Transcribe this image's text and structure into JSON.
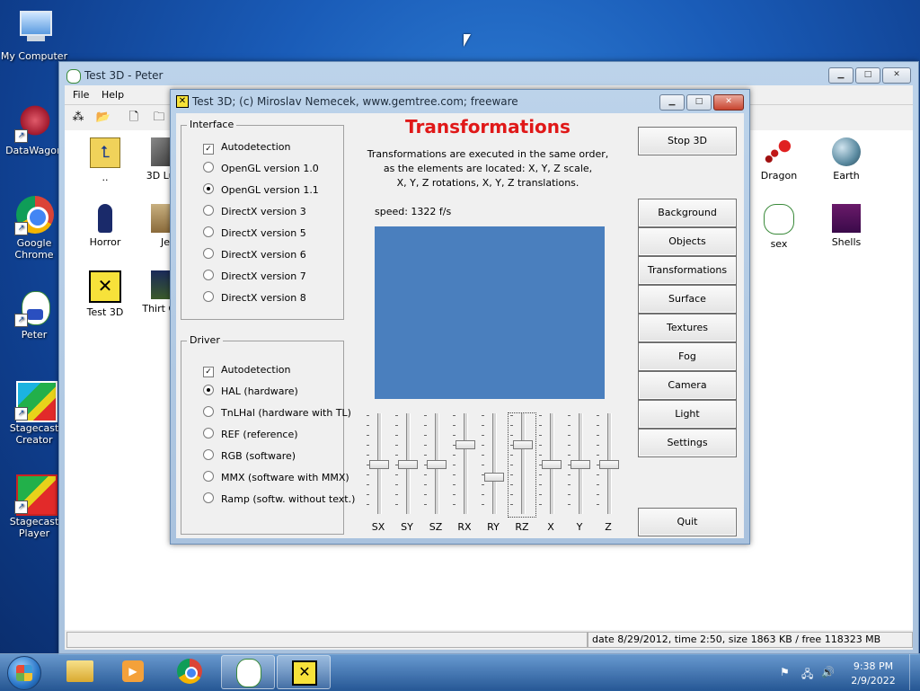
{
  "desktop": {
    "icons": [
      {
        "label": "My Computer"
      },
      {
        "label": "DataWagon"
      },
      {
        "label": "Google Chrome"
      },
      {
        "label": "Peter"
      },
      {
        "label": "Stagecast Creator"
      },
      {
        "label": "Stagecast Player"
      }
    ]
  },
  "explorer": {
    "title": "Test 3D - Peter",
    "menu": [
      "File",
      "Help"
    ],
    "files": [
      {
        "label": ".."
      },
      {
        "label": "3D Lum"
      },
      {
        "label": "Horror"
      },
      {
        "label": "Je"
      },
      {
        "label": "Test 3D"
      },
      {
        "label": "Thirt Gho"
      },
      {
        "label": "Dragon"
      },
      {
        "label": "Earth"
      },
      {
        "label": "sex"
      },
      {
        "label": "Shells"
      }
    ],
    "status": "date 8/29/2012, time 2:50, size 1863 KB / free 118323 MB"
  },
  "dialog": {
    "title": "Test 3D;  (c) Miroslav Nemecek, www.gemtree.com;   freeware",
    "heading": "Transformations",
    "description": [
      "Transformations are executed in the same order,",
      "as the elements are located: X, Y, Z scale,",
      "X, Y, Z rotations, X, Y, Z translations."
    ],
    "speed": "speed: 1322 f/s",
    "interface": {
      "label": "Interface",
      "autodetect": "Autodetection",
      "options": [
        "OpenGL version 1.0",
        "OpenGL version 1.1",
        "DirectX version 3",
        "DirectX version 5",
        "DirectX version 6",
        "DirectX version 7",
        "DirectX version 8"
      ],
      "selected": 1
    },
    "driver": {
      "label": "Driver",
      "autodetect": "Autodetection",
      "options": [
        "HAL (hardware)",
        "TnLHal (hardware with TL)",
        "REF (reference)",
        "RGB (software)",
        "MMX (software with MMX)",
        "Ramp (softw. without text.)"
      ],
      "selected": 0
    },
    "buttons": {
      "stop": "Stop 3D",
      "background": "Background",
      "objects": "Objects",
      "transformations": "Transformations",
      "surface": "Surface",
      "textures": "Textures",
      "fog": "Fog",
      "camera": "Camera",
      "light": "Light",
      "settings": "Settings",
      "quit": "Quit"
    },
    "sliders": [
      {
        "label": "SX",
        "value": 0.5
      },
      {
        "label": "SY",
        "value": 0.5
      },
      {
        "label": "SZ",
        "value": 0.5
      },
      {
        "label": "RX",
        "value": 0.29
      },
      {
        "label": "RY",
        "value": 0.63
      },
      {
        "label": "RZ",
        "value": 0.29
      },
      {
        "label": "X",
        "value": 0.5
      },
      {
        "label": "Y",
        "value": 0.5
      },
      {
        "label": "Z",
        "value": 0.5
      }
    ],
    "viewport_color": "#4a7fbe"
  },
  "tray": {
    "time": "9:38 PM",
    "date": "2/9/2022"
  }
}
